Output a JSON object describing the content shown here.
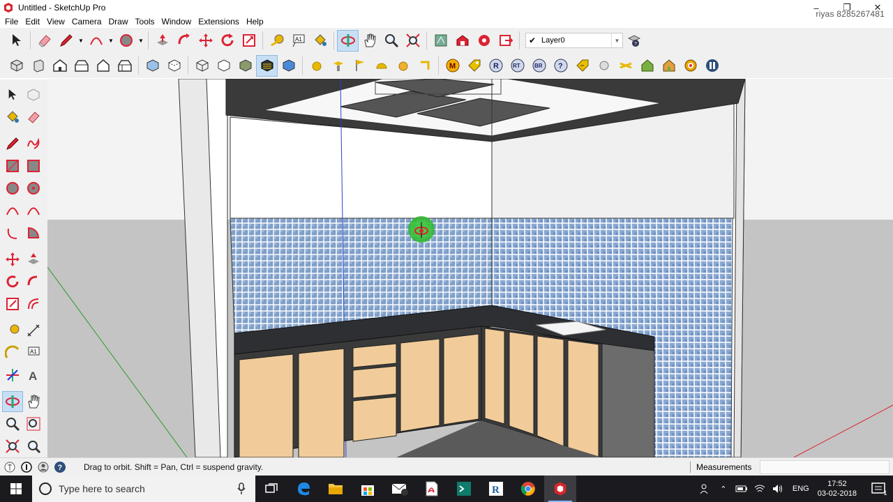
{
  "window": {
    "title": "Untitled - SketchUp Pro",
    "watermark": "riyas 8285267481",
    "controls": {
      "minimize": "–",
      "restore": "❐",
      "close": "✕"
    }
  },
  "menu": [
    "File",
    "Edit",
    "View",
    "Camera",
    "Draw",
    "Tools",
    "Window",
    "Extensions",
    "Help"
  ],
  "toolbar": {
    "layer": {
      "checked": "✔",
      "name": "Layer0"
    }
  },
  "status": {
    "hint": "Drag to orbit. Shift = Pan, Ctrl = suspend gravity.",
    "measurements_label": "Measurements",
    "measurements_value": ""
  },
  "taskbar": {
    "search_placeholder": "Type here to search",
    "language": "ENG",
    "time": "17:52",
    "date": "03-02-2018",
    "notification_count": "1"
  },
  "colors": {
    "toolbar_bg": "#f0f0f0",
    "active_tool": "#c7dff5",
    "taskbar_bg": "#1b1b1f",
    "tile_blue": "#7f9fc8",
    "cabinet_wood": "#f1cc9a",
    "countertop": "#2d2f33"
  }
}
